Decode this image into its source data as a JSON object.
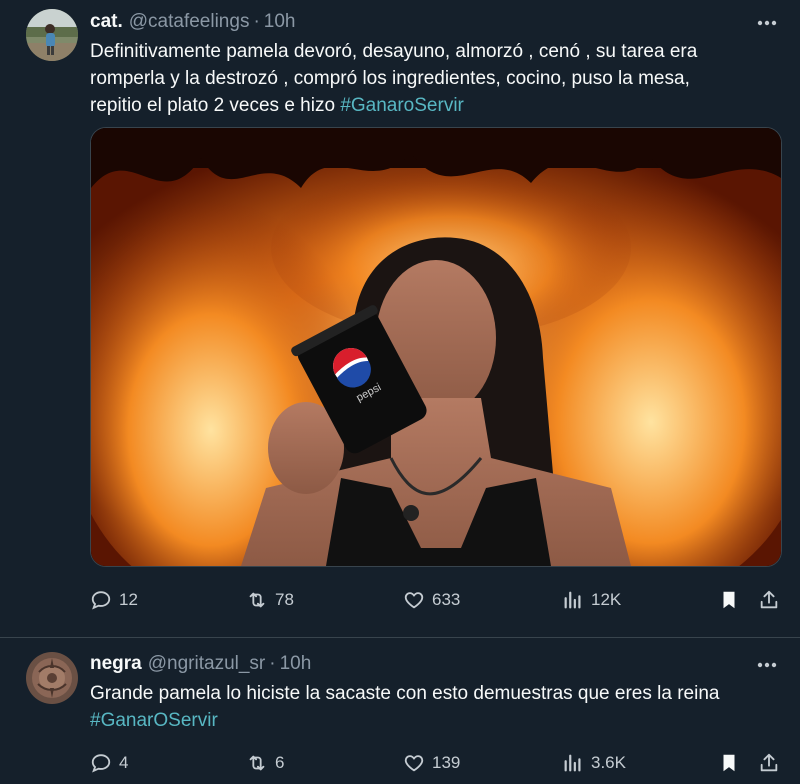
{
  "tweets": [
    {
      "display_name": "cat.",
      "handle": "@catafeelings",
      "separator": "·",
      "time": "10h",
      "text_lines": [
        "Definitivamente pamela devoró, desayuno, almorzó , cenó , su tarea era",
        "romperla y la destrozó , compró los ingredientes, cocino, puso la mesa,",
        "repitio el plato 2 veces e hizo "
      ],
      "hashtag": "#GanaroServir",
      "media_label": "pepsi",
      "replies": "12",
      "retweets": "78",
      "likes": "633",
      "views": "12K",
      "bookmarked": true
    },
    {
      "display_name": "negra",
      "handle": "@ngritazul_sr",
      "separator": "·",
      "time": "10h",
      "text_lines": [
        "Grande pamela lo hiciste la sacaste con esto demuestras que eres la reina"
      ],
      "hashtag": "#GanarOServir",
      "replies": "4",
      "retweets": "6",
      "likes": "139",
      "views": "3.6K",
      "bookmarked": true
    }
  ],
  "icons": {
    "reply": "reply-icon",
    "retweet": "retweet-icon",
    "like": "like-icon",
    "views": "views-icon",
    "bookmark": "bookmark-icon",
    "share": "share-icon",
    "more": "more-icon"
  },
  "colors": {
    "background": "#15202b",
    "divider": "#38444d",
    "text": "#f7f9f9",
    "muted": "#8b98a5",
    "hashtag": "#58b7c3"
  }
}
